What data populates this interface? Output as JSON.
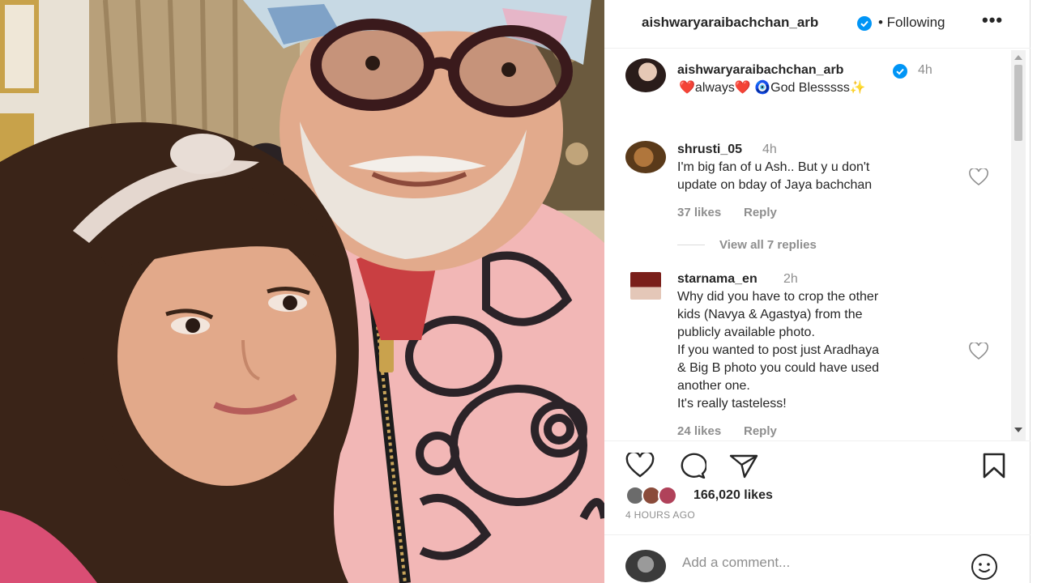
{
  "post": {
    "username": "aishwaryaraibachchan_arb",
    "follow_status": "• Following",
    "more_glyph": "•••",
    "caption": {
      "username": "aishwaryaraibachchan_arb",
      "time": "4h",
      "text": "❤️always❤️ 🧿God Blesssss✨"
    }
  },
  "comments": [
    {
      "username": "shrusti_05",
      "time": "4h",
      "lines": [
        "I'm big fan of u Ash.. But y u don't",
        "update on bday of Jaya bachchan"
      ],
      "likes": "37 likes",
      "reply": "Reply",
      "view_replies": "View all 7 replies"
    },
    {
      "username": "starnama_en",
      "time": "2h",
      "lines": [
        "Why did you have to crop the other",
        "kids (Navya & Agastya) from the",
        "publicly available photo.",
        "If you wanted to post just Aradhaya",
        "& Big B photo you could have used",
        "another one.",
        "It's really tasteless!"
      ],
      "likes": "24 likes",
      "reply": "Reply"
    }
  ],
  "engagement": {
    "likes": "166,020 likes",
    "time_ago": "4 HOURS AGO"
  },
  "comment_box": {
    "placeholder": "Add a comment..."
  },
  "colors": {
    "verified_blue": "#0095f6",
    "text_primary": "#262626",
    "text_secondary": "#8e8e8e"
  }
}
